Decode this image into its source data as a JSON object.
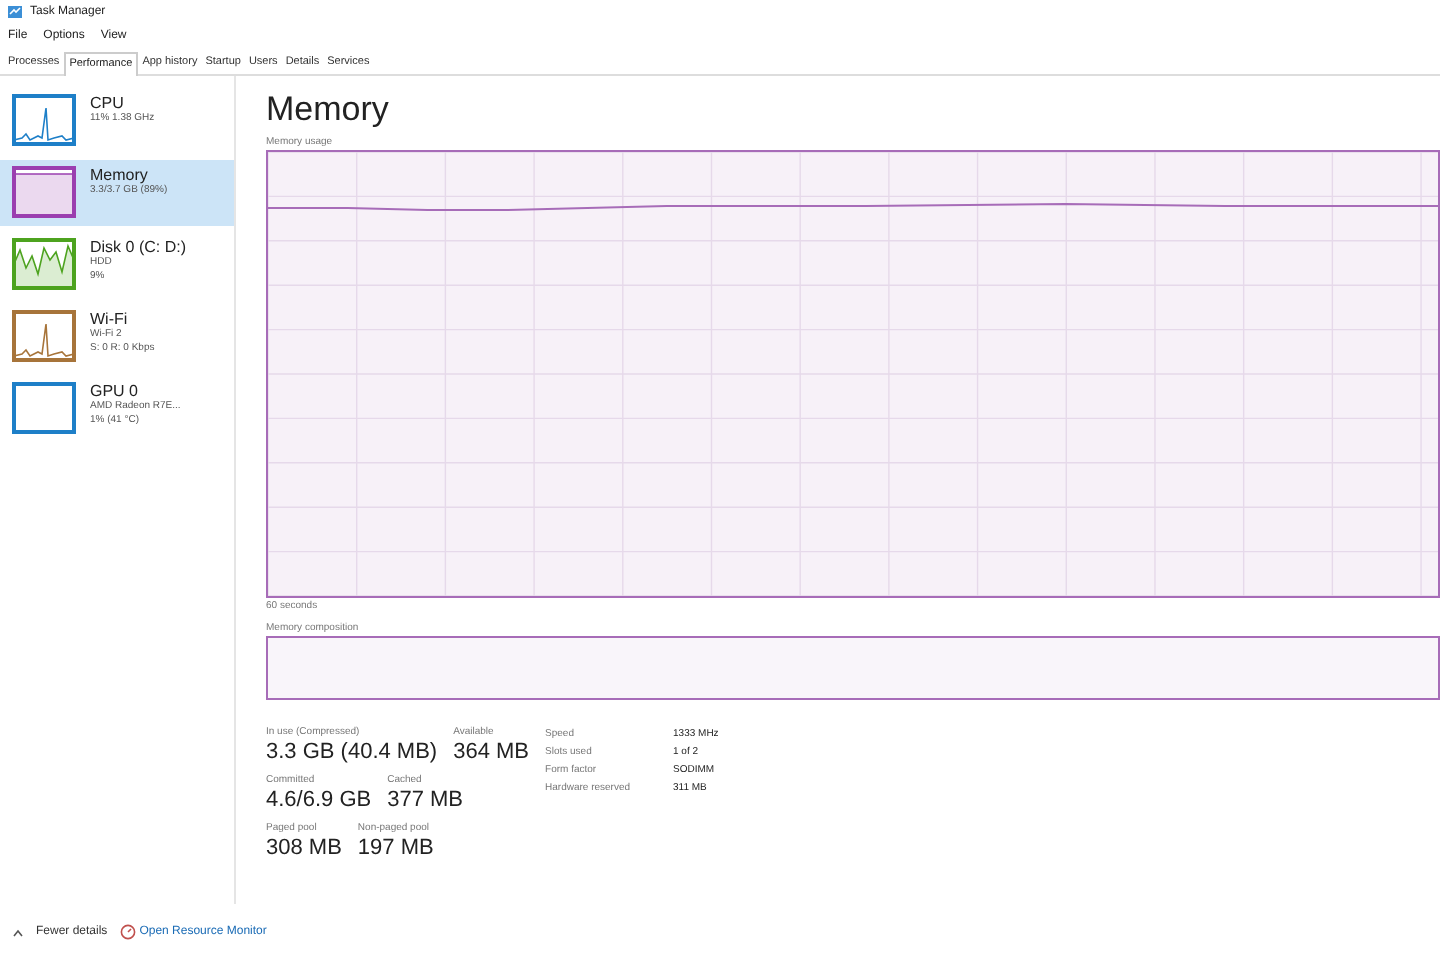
{
  "window": {
    "title": "Task Manager"
  },
  "menu": [
    "File",
    "Options",
    "View"
  ],
  "tabs": [
    {
      "label": "Processes",
      "selected": false
    },
    {
      "label": "Performance",
      "selected": true
    },
    {
      "label": "App history",
      "selected": false
    },
    {
      "label": "Startup",
      "selected": false
    },
    {
      "label": "Users",
      "selected": false
    },
    {
      "label": "Details",
      "selected": false
    },
    {
      "label": "Services",
      "selected": false
    }
  ],
  "sidebar": {
    "items": [
      {
        "name": "CPU",
        "lines": [
          "11% 1.38 GHz"
        ],
        "selected": false,
        "color": "#1e7fc8",
        "kind": "spiky"
      },
      {
        "name": "Memory",
        "lines": [
          "3.3/3.7 GB (89%)"
        ],
        "selected": true,
        "color": "#9b3fb0",
        "kind": "flat"
      },
      {
        "name": "Disk 0 (C: D:)",
        "lines": [
          "HDD",
          "9%"
        ],
        "selected": false,
        "color": "#4da31f",
        "kind": "busy"
      },
      {
        "name": "Wi-Fi",
        "lines": [
          "Wi-Fi 2",
          "S: 0 R: 0 Kbps"
        ],
        "selected": false,
        "color": "#a7743a",
        "kind": "spiky"
      },
      {
        "name": "GPU 0",
        "lines": [
          "AMD Radeon R7E...",
          "1% (41 °C)"
        ],
        "selected": false,
        "color": "#1e7fc8",
        "kind": "empty"
      }
    ]
  },
  "main": {
    "title": "Memory",
    "usage_label": "Memory usage",
    "time_label": "60 seconds",
    "composition_label": "Memory composition",
    "stats": [
      [
        {
          "label": "In use (Compressed)",
          "value": "3.3 GB (40.4 MB)"
        },
        {
          "label": "Available",
          "value": "364 MB"
        }
      ],
      [
        {
          "label": "Committed",
          "value": "4.6/6.9 GB"
        },
        {
          "label": "Cached",
          "value": "377 MB"
        }
      ],
      [
        {
          "label": "Paged pool",
          "value": "308 MB"
        },
        {
          "label": "Non-paged pool",
          "value": "197 MB"
        }
      ]
    ],
    "details": [
      {
        "label": "Speed",
        "value": "1333 MHz"
      },
      {
        "label": "Slots used",
        "value": "1 of 2"
      },
      {
        "label": "Form factor",
        "value": "SODIMM"
      },
      {
        "label": "Hardware reserved",
        "value": "311 MB"
      }
    ]
  },
  "footer": {
    "fewer_details": "Fewer details",
    "link": "Open Resource Monitor"
  }
}
